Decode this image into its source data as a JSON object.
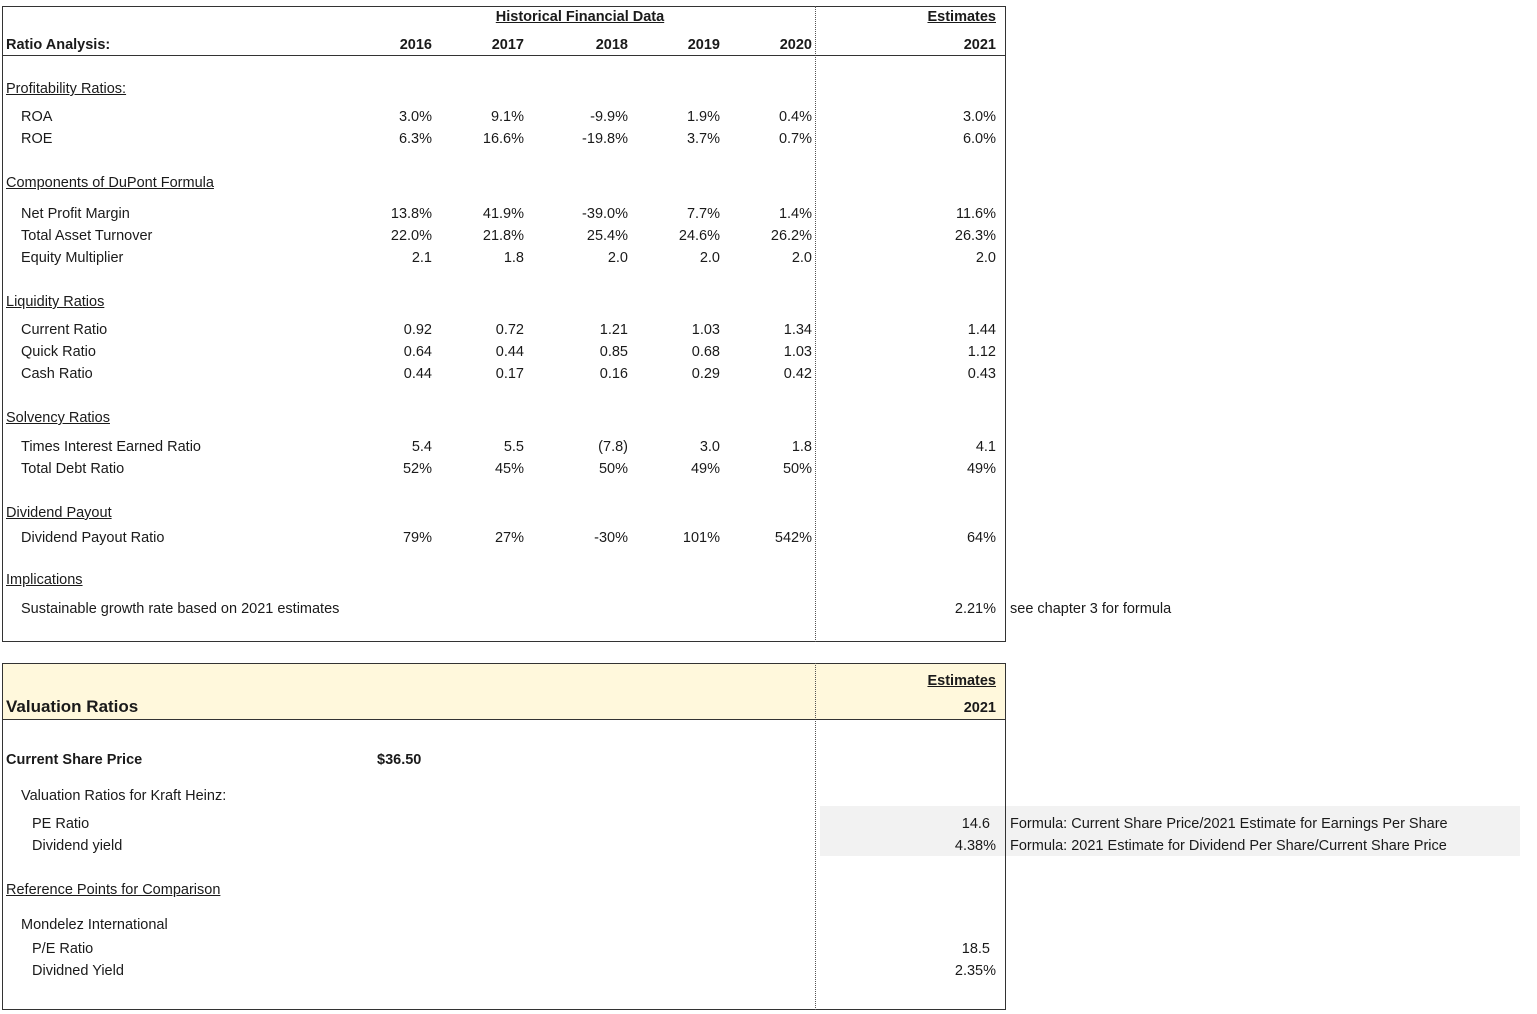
{
  "ratio": {
    "super_hist": "Historical Financial Data",
    "super_est": "Estimates",
    "title": "Ratio Analysis:",
    "years": [
      "2016",
      "2017",
      "2018",
      "2019",
      "2020"
    ],
    "est_year": "2021",
    "sections": [
      {
        "title": "Profitability Ratios:",
        "rows": [
          {
            "label": "ROA",
            "values": [
              "3.0%",
              "9.1%",
              "-9.9%",
              "1.9%",
              "0.4%"
            ],
            "est": "3.0%"
          },
          {
            "label": "ROE",
            "values": [
              "6.3%",
              "16.6%",
              "-19.8%",
              "3.7%",
              "0.7%"
            ],
            "est": "6.0%"
          }
        ]
      },
      {
        "title": "Components of DuPont Formula",
        "rows": [
          {
            "label": "Net Profit Margin",
            "values": [
              "13.8%",
              "41.9%",
              "-39.0%",
              "7.7%",
              "1.4%"
            ],
            "est": "11.6%"
          },
          {
            "label": "Total Asset Turnover",
            "values": [
              "22.0%",
              "21.8%",
              "25.4%",
              "24.6%",
              "26.2%"
            ],
            "est": "26.3%"
          },
          {
            "label": "Equity Multiplier",
            "values": [
              "2.1",
              "1.8",
              "2.0",
              "2.0",
              "2.0"
            ],
            "est": "2.0"
          }
        ]
      },
      {
        "title": "Liquidity Ratios",
        "rows": [
          {
            "label": "Current Ratio",
            "values": [
              "0.92",
              "0.72",
              "1.21",
              "1.03",
              "1.34"
            ],
            "est": "1.44"
          },
          {
            "label": "Quick Ratio",
            "values": [
              "0.64",
              "0.44",
              "0.85",
              "0.68",
              "1.03"
            ],
            "est": "1.12"
          },
          {
            "label": "Cash Ratio",
            "values": [
              "0.44",
              "0.17",
              "0.16",
              "0.29",
              "0.42"
            ],
            "est": "0.43"
          }
        ]
      },
      {
        "title": "Solvency Ratios",
        "rows": [
          {
            "label": "Times Interest Earned Ratio",
            "values": [
              "5.4",
              "5.5",
              "(7.8)",
              "3.0",
              "1.8"
            ],
            "est": "4.1"
          },
          {
            "label": "Total Debt Ratio",
            "values": [
              "52%",
              "45%",
              "50%",
              "49%",
              "50%"
            ],
            "est": "49%"
          }
        ]
      },
      {
        "title": "Dividend Payout",
        "rows": [
          {
            "label": "Dividend Payout Ratio",
            "values": [
              "79%",
              "27%",
              "-30%",
              "101%",
              "542%"
            ],
            "est": "64%"
          }
        ]
      }
    ],
    "implications": {
      "title": "Implications",
      "label": "Sustainable growth rate based on 2021 estimates",
      "value": "2.21%",
      "note": "see chapter 3 for formula"
    }
  },
  "valuation": {
    "title": "Valuation Ratios",
    "super_est": "Estimates",
    "est_year": "2021",
    "price_label": "Current Share Price",
    "price_value": "$36.50",
    "sub_heading": "Valuation Ratios for Kraft Heinz:",
    "pe_label": "PE Ratio",
    "pe_value": "14.6",
    "pe_note": "Formula:  Current Share Price/2021 Estimate for Earnings Per Share",
    "dy_label": "Dividend yield",
    "dy_value": "4.38%",
    "dy_note": "Formula:  2021 Estimate for Dividend Per Share/Current Share Price",
    "ref_title": "Reference Points for Comparison",
    "comp_name": "Mondelez International",
    "comp_pe_label": "P/E Ratio",
    "comp_pe_value": "18.5",
    "comp_dy_label": "Dividned Yield",
    "comp_dy_value": "2.35%"
  }
}
